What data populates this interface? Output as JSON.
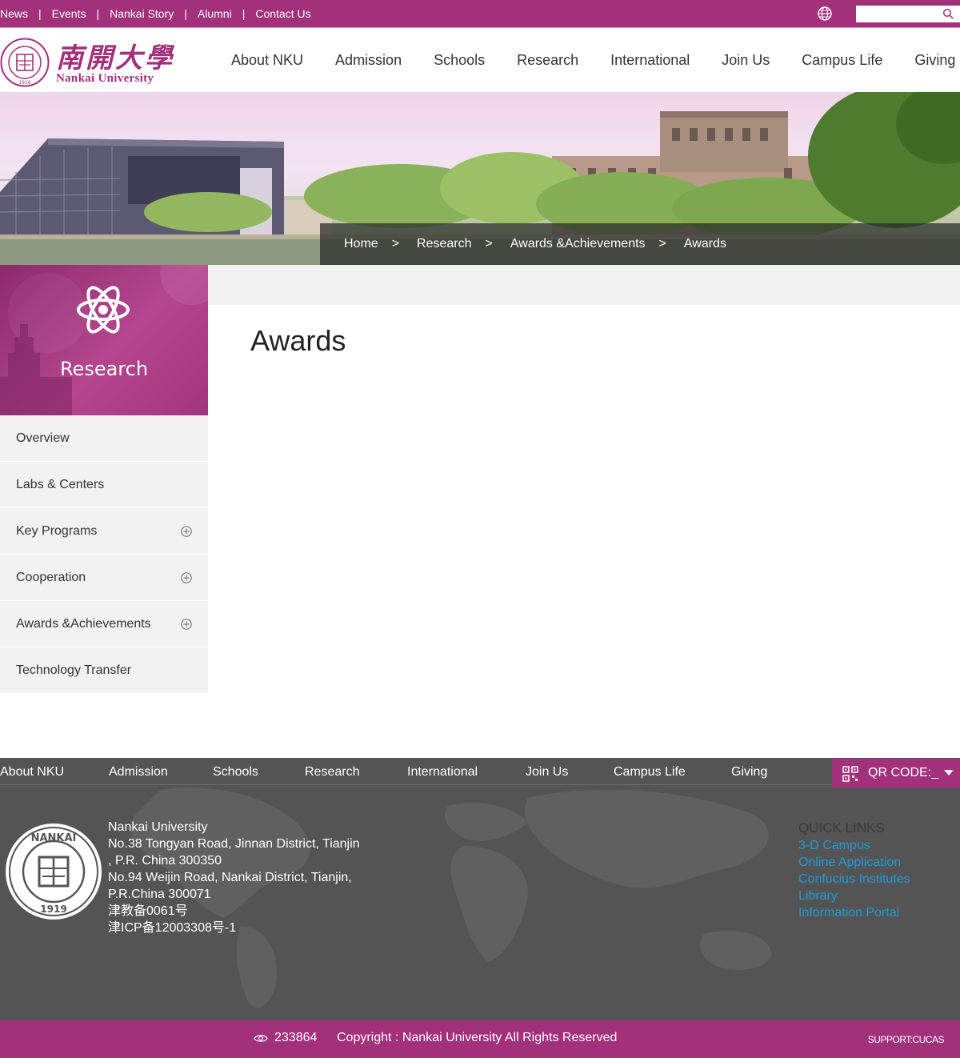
{
  "topbar": {
    "links": [
      "News",
      "Events",
      "Nankai Story",
      "Alumni",
      "Contact Us"
    ],
    "separator": "|",
    "search_placeholder": "",
    "globe_icon": "globe-icon",
    "search_icon": "search-icon"
  },
  "header": {
    "logo_cn": "南開大學",
    "logo_en": "Nankai University",
    "nav": [
      "About NKU",
      "Admission",
      "Schools",
      "Research",
      "International",
      "Join Us",
      "Campus Life",
      "Giving"
    ]
  },
  "breadcrumb": {
    "items": [
      "Home",
      "Research",
      "Awards &Achievements",
      "Awards"
    ],
    "separator": ">"
  },
  "sidebar": {
    "title": "Research",
    "icon": "atom-icon",
    "items": [
      {
        "label": "Overview",
        "expandable": false
      },
      {
        "label": "Labs & Centers",
        "expandable": false
      },
      {
        "label": "Key Programs",
        "expandable": true
      },
      {
        "label": "Cooperation",
        "expandable": true
      },
      {
        "label": "Awards &Achievements",
        "expandable": true
      },
      {
        "label": "Technology Transfer",
        "expandable": false
      }
    ]
  },
  "main": {
    "title": "Awards"
  },
  "footer": {
    "nav": [
      "About NKU",
      "Admission",
      "Schools",
      "Research",
      "International",
      "Join Us",
      "Campus Life",
      "Giving"
    ],
    "qr_label": "QR CODE:_",
    "address_lines": [
      "Nankai University",
      "No.38 Tongyan Road, Jinnan District, Tianjin",
      ", P.R. China 300350",
      "No.94 Weijin Road,  Nankai District, Tianjin,",
      "P.R.China  300071",
      "津教备0061号",
      "津ICP备12003308号-1"
    ],
    "quick_links_title": "QUICK LINKS",
    "quick_links": [
      "3-D Campus",
      "Online Application",
      "Confucius Institutes",
      "Library",
      "Information Portal"
    ]
  },
  "bottom": {
    "visits": "233864",
    "copyright": "Copyright : Nankai University All Rights Reserved",
    "support": "SUPPORT:CUCAS"
  },
  "colors": {
    "brand": "#a3307a",
    "footer_bg": "#545454",
    "link": "#1e9bd8",
    "side_bg": "#f2f2f2"
  }
}
